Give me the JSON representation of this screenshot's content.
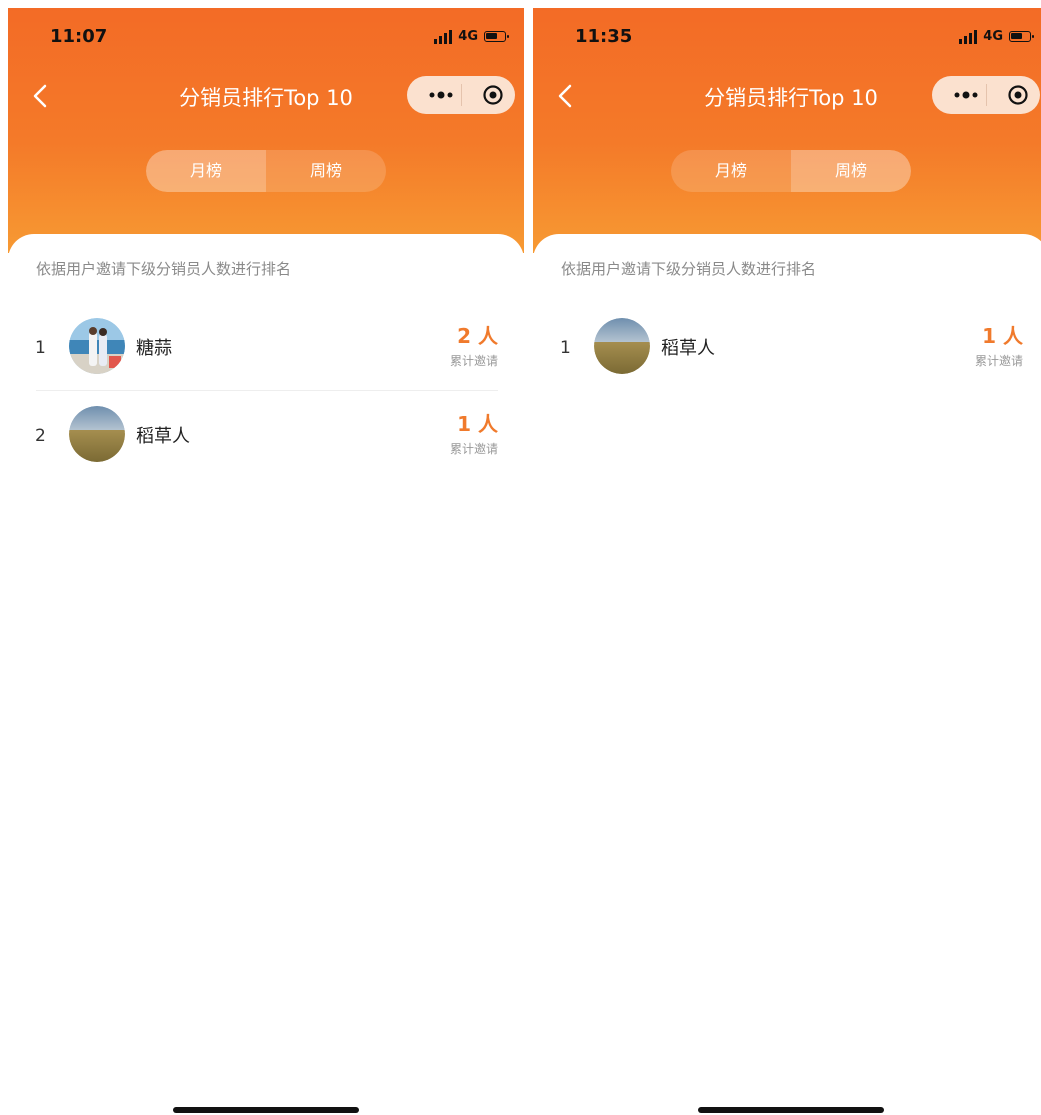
{
  "colors": {
    "accent": "#f07a2c",
    "header_top": "#f36b26",
    "header_bottom": "#f79a33"
  },
  "screens": [
    {
      "status": {
        "time": "11:07",
        "network": "4G"
      },
      "nav": {
        "title": "分销员排行Top 10"
      },
      "tabs": [
        {
          "label": "月榜",
          "active": true
        },
        {
          "label": "周榜",
          "active": false
        }
      ],
      "description": "依据用户邀请下级分销员人数进行排名",
      "entries": [
        {
          "rank": "1",
          "name": "糖蒜",
          "count": "2 人",
          "sub": "累计邀请",
          "avatar": "couple-photo"
        },
        {
          "rank": "2",
          "name": "稻草人",
          "count": "1 人",
          "sub": "累计邀请",
          "avatar": "field-landscape"
        }
      ]
    },
    {
      "status": {
        "time": "11:35",
        "network": "4G"
      },
      "nav": {
        "title": "分销员排行Top 10"
      },
      "tabs": [
        {
          "label": "月榜",
          "active": false
        },
        {
          "label": "周榜",
          "active": true
        }
      ],
      "description": "依据用户邀请下级分销员人数进行排名",
      "entries": [
        {
          "rank": "1",
          "name": "稻草人",
          "count": "1 人",
          "sub": "累计邀请",
          "avatar": "field-landscape"
        }
      ]
    }
  ]
}
